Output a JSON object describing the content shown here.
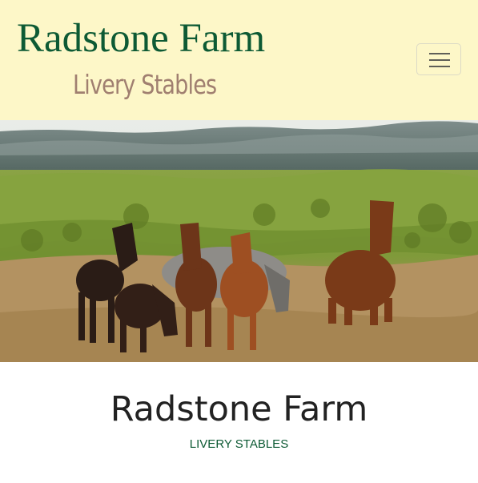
{
  "header": {
    "brand_title": "Radstone Farm",
    "brand_subtitle": "Livery Stables",
    "menu_icon": "hamburger-menu-icon"
  },
  "hero": {
    "image": "wild-horses-in-grassland-photo"
  },
  "intro": {
    "title": "Radstone Farm",
    "subtitle": "LIVERY STABLES"
  },
  "colors": {
    "header_background": "#fdf7c8",
    "brand_green": "#0d5a34",
    "subtitle_brown": "#a07f70",
    "body_text": "#222222"
  }
}
